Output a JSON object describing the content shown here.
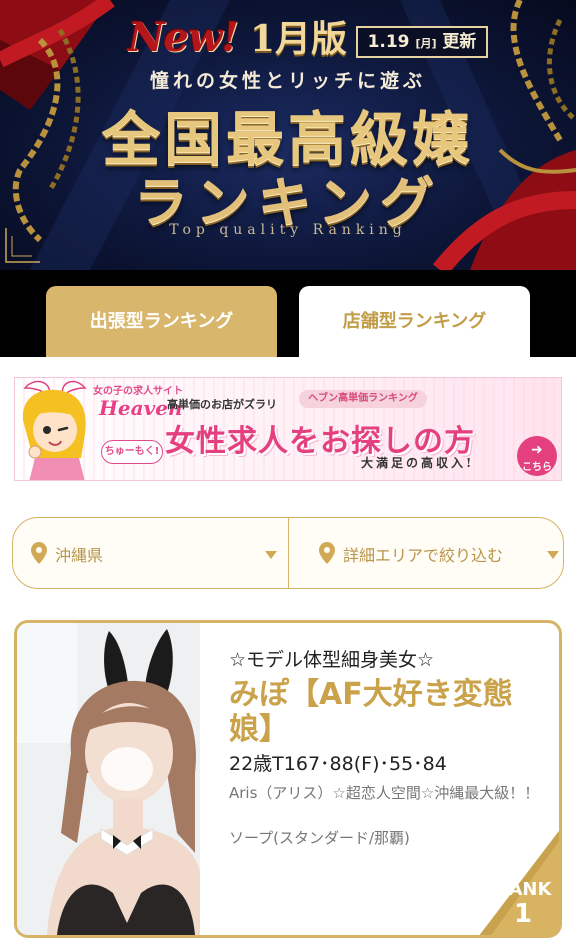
{
  "hero": {
    "new_label": "New!",
    "month_label": "1月版",
    "date_main": "1.19",
    "date_weekday": "[月]",
    "date_suffix": "更新",
    "tagline": "憧れの女性とリッチに遊ぶ",
    "title_line1": "全国最高級嬢",
    "title_line2": "ランキング",
    "subtitle": "Top quality Ranking"
  },
  "tabs": [
    {
      "label": "出張型ランキング",
      "active": false
    },
    {
      "label": "店舗型ランキング",
      "active": true
    }
  ],
  "banner": {
    "logo_small": "女の子の求人サイト",
    "logo_main": "Heaven",
    "bubble": "ちゅーもく!",
    "note": "高単価のお店がズラリ",
    "ribbon": "ヘブン高単価ランキング",
    "headline": "女性求人をお探しの方",
    "footer": "大満足の高収入!",
    "cta": "こちら"
  },
  "filter": {
    "prefecture": "沖縄県",
    "area_placeholder": "詳細エリアで絞り込む"
  },
  "card": {
    "catchphrase": "☆モデル体型細身美女☆",
    "name": "みぽ【AF大好き変態娘】",
    "specs": "22歳T167･88(F)･55･84",
    "shop": "Aris（アリス）☆超恋人空間☆沖縄最大級！！",
    "category": "ソープ(スタンダード/那覇)",
    "rank_label": "RANK",
    "rank_number": "1"
  },
  "colors": {
    "gold": "#d5b468",
    "gold_text": "#caa24a",
    "hero_navy": "#0d1638",
    "pink": "#e4407f"
  },
  "icons": {
    "location": "map-pin-icon",
    "dropdown": "caret-down-icon",
    "cta_arrow": "arrow-right-icon"
  }
}
